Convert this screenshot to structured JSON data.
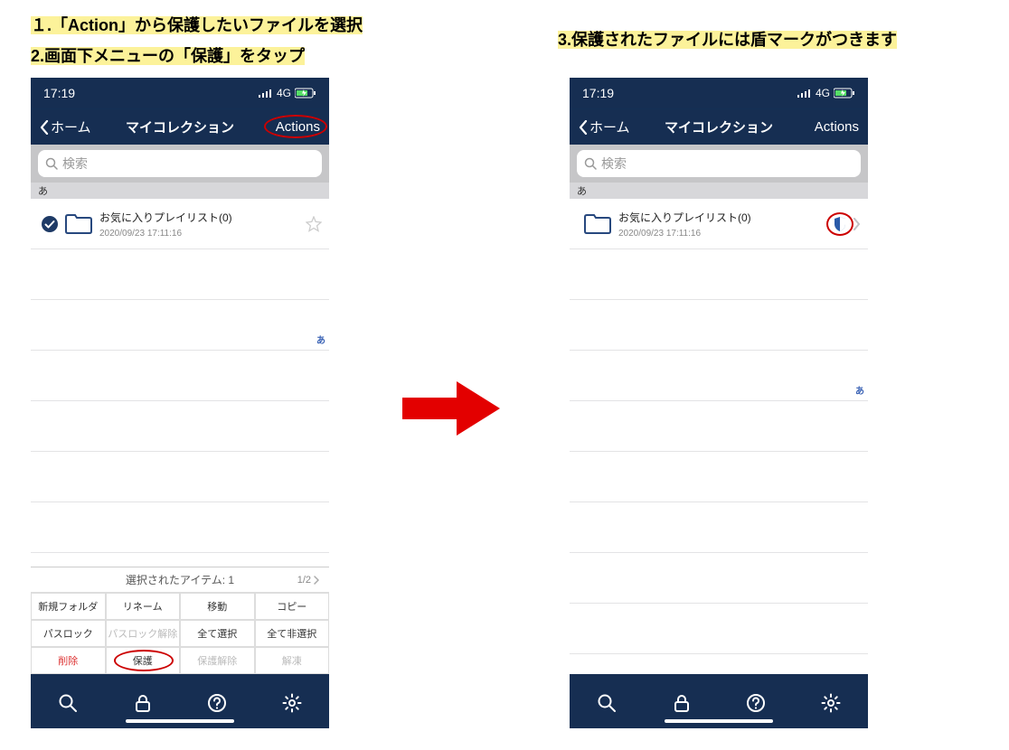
{
  "captions": {
    "step1": "１.「Action」から保護したいファイルを選択",
    "step2": "2.画面下メニューの「保護」をタップ",
    "step3": "3.保護されたファイルには盾マークがつきます"
  },
  "statusbar": {
    "time": "17:19",
    "network": "4G"
  },
  "navbar": {
    "back_label": "ホーム",
    "title": "マイコレクション",
    "actions_label": "Actions"
  },
  "search": {
    "placeholder": "検索"
  },
  "section_letter": "あ",
  "list_item": {
    "name": "お気に入りプレイリスト(0)",
    "date": "2020/09/23 17:11:16"
  },
  "action_panel": {
    "header": "選択されたアイテム: 1",
    "pager": "1/2",
    "cells": [
      {
        "label": "新規フォルダ",
        "state": "normal"
      },
      {
        "label": "リネーム",
        "state": "normal"
      },
      {
        "label": "移動",
        "state": "normal"
      },
      {
        "label": "コピー",
        "state": "normal"
      },
      {
        "label": "パスロック",
        "state": "normal"
      },
      {
        "label": "パスロック解除",
        "state": "disabled"
      },
      {
        "label": "全て選択",
        "state": "normal"
      },
      {
        "label": "全て非選択",
        "state": "normal"
      },
      {
        "label": "削除",
        "state": "danger"
      },
      {
        "label": "保護",
        "state": "normal"
      },
      {
        "label": "保護解除",
        "state": "disabled"
      },
      {
        "label": "解凍",
        "state": "disabled"
      }
    ]
  },
  "index_letter_side": "あ"
}
